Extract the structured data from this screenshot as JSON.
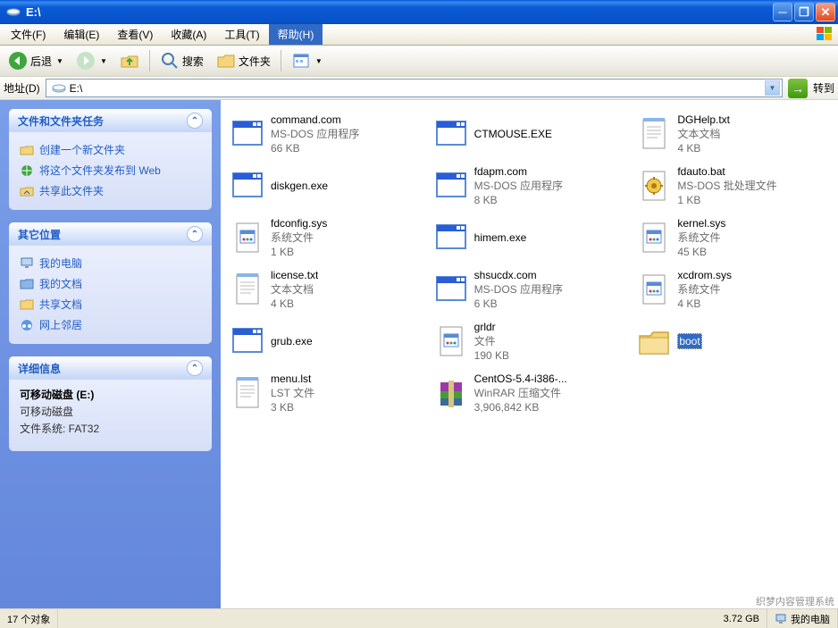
{
  "window": {
    "title": "E:\\"
  },
  "menu": {
    "items": [
      "文件(F)",
      "编辑(E)",
      "查看(V)",
      "收藏(A)",
      "工具(T)",
      "帮助(H)"
    ],
    "active_index": 5
  },
  "toolbar": {
    "back_label": "后退",
    "search_label": "搜索",
    "folders_label": "文件夹"
  },
  "address": {
    "label": "地址(D)",
    "value": "E:\\",
    "go_label": "转到"
  },
  "sidebar": {
    "panel1": {
      "title": "文件和文件夹任务",
      "links": [
        {
          "icon": "new-folder",
          "label": "创建一个新文件夹"
        },
        {
          "icon": "publish-web",
          "label": "将这个文件夹发布到 Web"
        },
        {
          "icon": "share",
          "label": "共享此文件夹"
        }
      ]
    },
    "panel2": {
      "title": "其它位置",
      "links": [
        {
          "icon": "my-computer",
          "label": "我的电脑"
        },
        {
          "icon": "my-documents",
          "label": "我的文档"
        },
        {
          "icon": "shared-docs",
          "label": "共享文档"
        },
        {
          "icon": "network",
          "label": "网上邻居"
        }
      ]
    },
    "panel3": {
      "title": "详细信息",
      "drive_title": "可移动磁盘 (E:)",
      "drive_type": "可移动磁盘",
      "fs_line": "文件系统: FAT32"
    }
  },
  "files": [
    {
      "name": "command.com",
      "desc": "MS-DOS 应用程序",
      "size": "66 KB",
      "icon": "exe"
    },
    {
      "name": "CTMOUSE.EXE",
      "desc": "",
      "size": "",
      "icon": "exe"
    },
    {
      "name": "DGHelp.txt",
      "desc": "文本文档",
      "size": "4 KB",
      "icon": "txt"
    },
    {
      "name": "diskgen.exe",
      "desc": "",
      "size": "",
      "icon": "exe"
    },
    {
      "name": "fdapm.com",
      "desc": "MS-DOS 应用程序",
      "size": "8 KB",
      "icon": "exe"
    },
    {
      "name": "fdauto.bat",
      "desc": "MS-DOS 批处理文件",
      "size": "1 KB",
      "icon": "bat"
    },
    {
      "name": "fdconfig.sys",
      "desc": "系统文件",
      "size": "1 KB",
      "icon": "sys"
    },
    {
      "name": "himem.exe",
      "desc": "",
      "size": "",
      "icon": "exe"
    },
    {
      "name": "kernel.sys",
      "desc": "系统文件",
      "size": "45 KB",
      "icon": "sys"
    },
    {
      "name": "license.txt",
      "desc": "文本文档",
      "size": "4 KB",
      "icon": "txt"
    },
    {
      "name": "shsucdx.com",
      "desc": "MS-DOS 应用程序",
      "size": "6 KB",
      "icon": "exe"
    },
    {
      "name": "xcdrom.sys",
      "desc": "系统文件",
      "size": "4 KB",
      "icon": "sys"
    },
    {
      "name": "grub.exe",
      "desc": "",
      "size": "",
      "icon": "exe"
    },
    {
      "name": "grldr",
      "desc": "文件",
      "size": "190 KB",
      "icon": "sys"
    },
    {
      "name": "boot",
      "desc": "",
      "size": "",
      "icon": "folder",
      "selected": true
    },
    {
      "name": "menu.lst",
      "desc": "LST 文件",
      "size": "3 KB",
      "icon": "txt"
    },
    {
      "name": "CentOS-5.4-i386-...",
      "desc": "WinRAR 压缩文件",
      "size": "3,906,842 KB",
      "icon": "rar"
    }
  ],
  "statusbar": {
    "object_count": "17 个对象",
    "size": "3.72 GB",
    "location": "我的电脑"
  },
  "watermark": "织梦内容管理系统"
}
